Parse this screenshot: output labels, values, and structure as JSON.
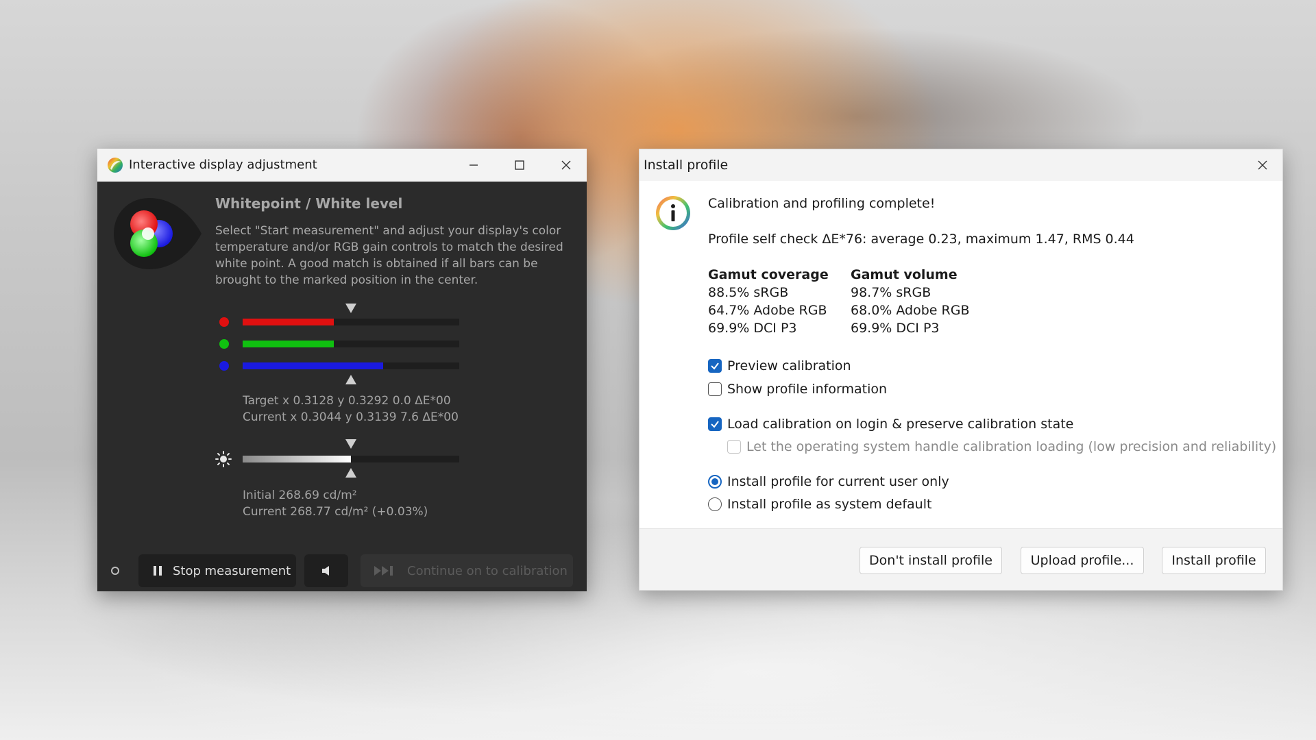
{
  "ida": {
    "title": "Interactive display adjustment",
    "heading": "Whitepoint / White level",
    "description": "Select \"Start measurement\" and adjust your display's color temperature and/or RGB gain controls to match the desired white point. A good match is obtained if all bars can be brought to the marked position in the center.",
    "channels": [
      {
        "name": "red",
        "color": "#e01010",
        "level": 0.42
      },
      {
        "name": "green",
        "color": "#10c010",
        "level": 0.42
      },
      {
        "name": "blue",
        "color": "#1a1ae0",
        "level": 0.65
      }
    ],
    "target_line": "Target x 0.3128 y 0.3292 0.0 ΔE*00",
    "current_line": "Current x 0.3044 y 0.3139 7.6 ΔE*00",
    "brightness_level": 0.5,
    "initial_luminance": "Initial 268.69 cd/m²",
    "current_luminance": "Current 268.77 cd/m² (+0.03%)",
    "stop_label": "Stop measurement",
    "continue_label": "Continue on to calibration"
  },
  "ip": {
    "title": "Install profile",
    "complete_msg": "Calibration and profiling complete!",
    "selfcheck": "Profile self check ΔE*76: average 0.23, maximum 1.47, RMS 0.44",
    "gamut_coverage": {
      "header": "Gamut coverage",
      "rows": [
        "88.5% sRGB",
        "64.7% Adobe RGB",
        "69.9% DCI P3"
      ]
    },
    "gamut_volume": {
      "header": "Gamut volume",
      "rows": [
        "98.7% sRGB",
        "68.0% Adobe RGB",
        "69.9% DCI P3"
      ]
    },
    "preview_calibration": "Preview calibration",
    "show_profile_info": "Show profile information",
    "load_calibration": "Load calibration on login & preserve calibration state",
    "os_handle": "Let the operating system handle calibration loading (low precision and reliability)",
    "install_current_user": "Install profile for current user only",
    "install_system_default": "Install profile as system default",
    "dont_install": "Don't install profile",
    "upload": "Upload profile...",
    "install": "Install profile"
  },
  "colors": {
    "accent": "#1665c1",
    "dark_window_bg": "#2b2b2b"
  }
}
